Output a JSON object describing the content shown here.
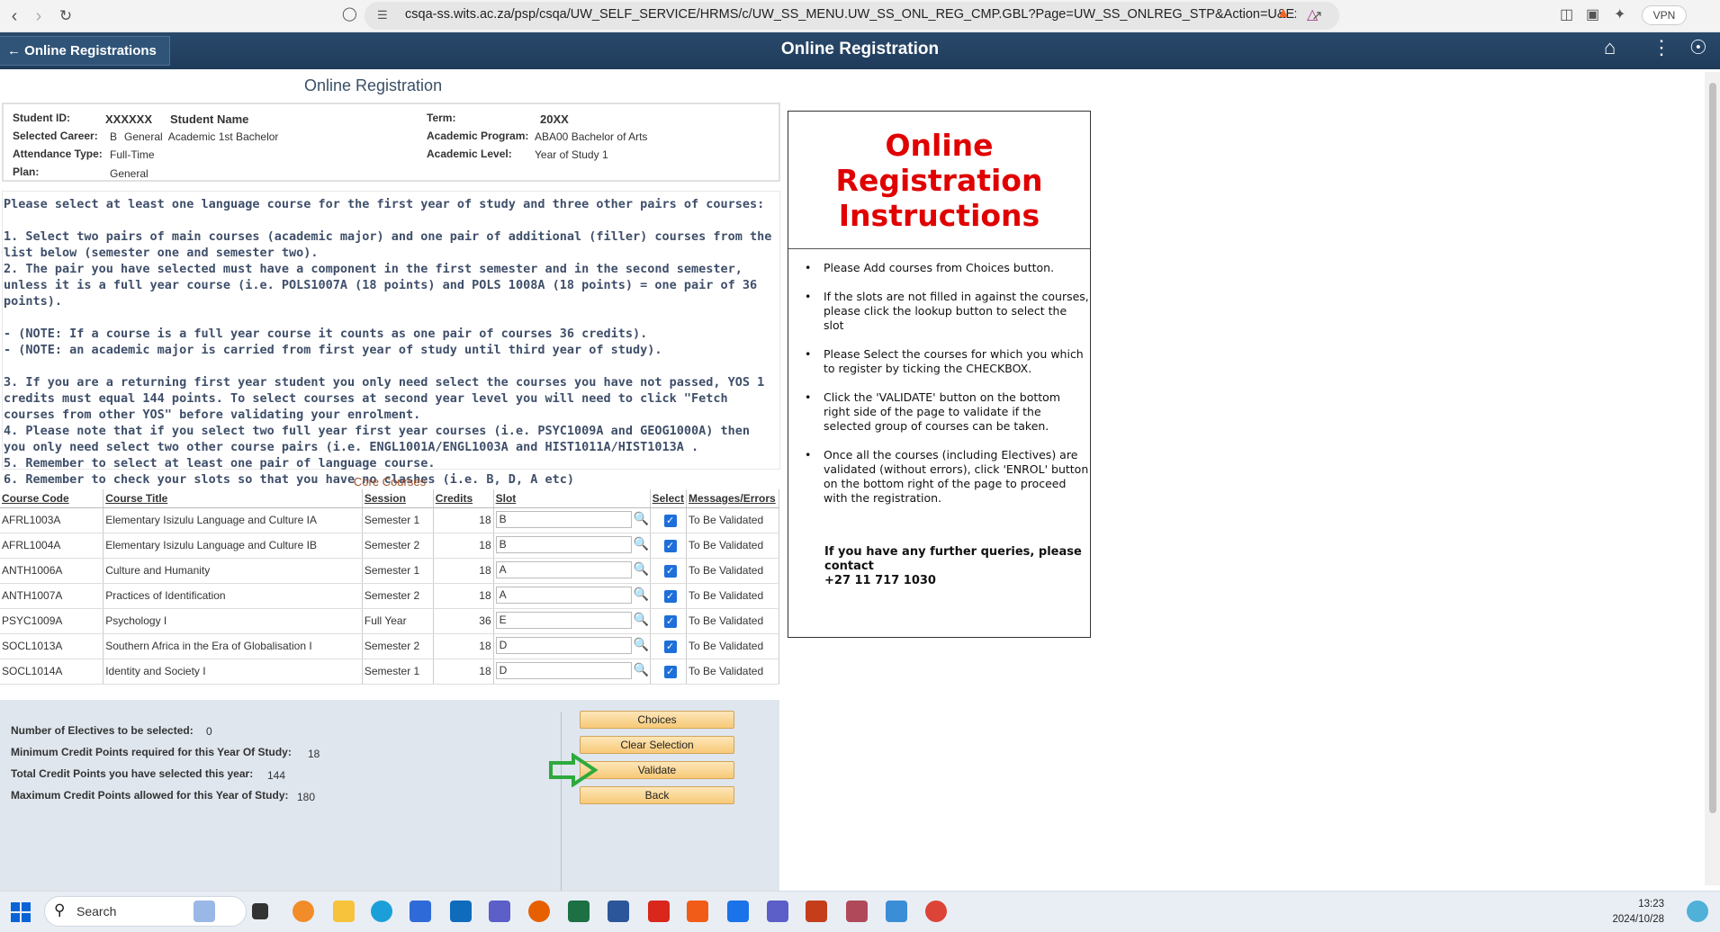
{
  "browser": {
    "url": "csqa-ss.wits.ac.za/psp/csqa/UW_SELF_SERVICE/HRMS/c/UW_SS_MENU.UW_SS_ONL_REG_CMP.GBL?Page=UW_SS_ONLREG_STP&Action=U&ExactK...",
    "vpn_label": "VPN"
  },
  "header": {
    "back_label": "Online Registrations",
    "title": "Online Registration"
  },
  "page": {
    "heading": "Online Registration"
  },
  "student": {
    "id_label": "Student ID:",
    "id": "XXXXXX",
    "name": "Student Name",
    "career_label": "Selected Career:",
    "career_code": "B",
    "career_value": "General  Academic 1st Bachelor",
    "attendance_label": "Attendance Type:",
    "attendance": "Full-Time",
    "plan_label": "Plan:",
    "plan": "General",
    "term_label": "Term:",
    "term": "20XX",
    "program_label": "Academic Program:",
    "program": "ABA00 Bachelor of Arts",
    "level_label": "Academic Level:",
    "level": "Year of Study 1"
  },
  "instructions": [
    "Please select at least one language course for the first year of study and three other pairs of courses:",
    "",
    "1. Select two pairs of main courses (academic major) and one pair of additional (filler) courses from the list below (semester one and semester two).",
    "2. The pair you have selected must have a component in the first semester and in the second semester, unless it is a full year course (i.e. POLS1007A (18 points) and POLS 1008A (18 points) = one pair of 36 points).",
    "",
    "- (NOTE: If a course is a full year course it counts as one pair of courses 36 credits).",
    "- (NOTE: an academic major is carried from first year of study until third year of study).",
    "",
    "3. If you are a returning first year student you only need select the courses you have not passed, YOS 1 credits must equal 144 points. To select courses at second year level you will need to click \"Fetch courses from other YOS\" before validating your enrolment.",
    "4. Please note that if you select two full year first year courses (i.e. PSYC1009A and GEOG1000A) then you only need select two other course pairs (i.e. ENGL1001A/ENGL1003A and HIST1011A/HIST1013A .",
    "5. Remember to select at least one pair of language course.",
    "6. Remember to check your slots so that you have no clashes (i.e. B, D, A etc)"
  ],
  "core": {
    "title": "Core Courses",
    "columns": [
      "Course Code",
      "Course Title",
      "Session",
      "Credits",
      "Slot",
      "Select",
      "Messages/Errors"
    ],
    "rows": [
      {
        "code": "AFRL1003A",
        "title": "Elementary Isizulu Language and Culture IA",
        "session": "Semester 1",
        "credits": "18",
        "slot": "B",
        "msg": "To Be Validated"
      },
      {
        "code": "AFRL1004A",
        "title": "Elementary Isizulu Language and Culture IB",
        "session": "Semester 2",
        "credits": "18",
        "slot": "B",
        "msg": "To Be Validated"
      },
      {
        "code": "ANTH1006A",
        "title": "Culture and Humanity",
        "session": "Semester 1",
        "credits": "18",
        "slot": "A",
        "msg": "To Be Validated"
      },
      {
        "code": "ANTH1007A",
        "title": "Practices of Identification",
        "session": "Semester 2",
        "credits": "18",
        "slot": "A",
        "msg": "To Be Validated"
      },
      {
        "code": "PSYC1009A",
        "title": "Psychology I",
        "session": "Full Year",
        "credits": "36",
        "slot": "E",
        "msg": "To Be Validated"
      },
      {
        "code": "SOCL1013A",
        "title": "Southern Africa in the Era of Globalisation I",
        "session": "Semester 2",
        "credits": "18",
        "slot": "D",
        "msg": "To Be Validated"
      },
      {
        "code": "SOCL1014A",
        "title": "Identity and Society I",
        "session": "Semester 1",
        "credits": "18",
        "slot": "D",
        "msg": "To Be Validated"
      }
    ]
  },
  "summary": {
    "electives_label": "Number of Electives to be selected:",
    "electives": "0",
    "min_label": "Minimum Credit Points required for this Year Of Study:",
    "min": "18",
    "total_label": "Total Credit Points you have selected this year:",
    "total": "144",
    "max_label": "Maximum Credit Points allowed for this Year of Study:",
    "max": "180"
  },
  "buttons": {
    "choices": "Choices",
    "clear": "Clear Selection",
    "validate": "Validate",
    "back": "Back"
  },
  "side_panel": {
    "title": "Online Registration Instructions",
    "items": [
      "Please Add courses from Choices button.",
      "If the slots are not filled in against the courses, please click the lookup button to select the slot",
      "Please Select the courses for which you which to register by ticking the CHECKBOX.",
      "Click the 'VALIDATE' button on the bottom right side of the page to validate if the selected group of courses can be taken.",
      "Once all the courses (including Electives) are validated (without errors), click 'ENROL' button on the bottom right of the page to proceed with the registration."
    ],
    "queries_line1": "If you have any further queries, please contact",
    "queries_phone": "+27 11 717 1030"
  },
  "taskbar": {
    "search_placeholder": "Search",
    "time": "13:23",
    "date": "2024/10/28"
  },
  "colors": {
    "header_bg": "#1f3b5a",
    "instruction_title": "#e00000",
    "button_bg": "#f7c978",
    "checkbox": "#1e6fd9",
    "arrow": "#2eaa3c"
  }
}
